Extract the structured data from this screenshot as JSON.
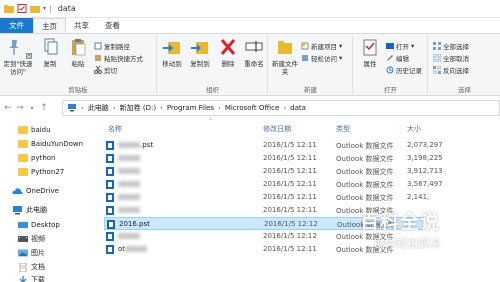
{
  "window": {
    "title": "data"
  },
  "tabs": [
    {
      "label": "文件"
    },
    {
      "label": "主页"
    },
    {
      "label": "共享"
    },
    {
      "label": "查看"
    }
  ],
  "ribbon": {
    "clipboard": {
      "pin_label": "固定到\"快速访问\"",
      "copy_label": "复制",
      "paste_label": "粘贴",
      "copy_path_label": "复制路径",
      "paste_shortcut_label": "粘贴快捷方式",
      "cut_label": "剪切",
      "group_label": "剪贴板"
    },
    "organize": {
      "move_to_label": "移动到",
      "copy_to_label": "复制到",
      "delete_label": "删除",
      "rename_label": "重命名",
      "group_label": "组织"
    },
    "new": {
      "new_folder_label": "新建文件夹",
      "new_item_label": "新建项目",
      "easy_access_label": "轻松访问",
      "group_label": "新建"
    },
    "open": {
      "properties_label": "属性",
      "open_label": "打开",
      "edit_label": "编辑",
      "history_label": "历史记录",
      "group_label": "打开"
    },
    "select": {
      "select_all_label": "全部选择",
      "select_none_label": "全部取消",
      "invert_label": "反向选择",
      "group_label": "选择"
    }
  },
  "address": {
    "crumbs": [
      "此电脑",
      "新加卷 (D:)",
      "Program Files",
      "Microsoft Office",
      "data"
    ]
  },
  "nav": {
    "quick_folders": [
      "baidu",
      "BaiduYunDown",
      "python",
      "Python27"
    ],
    "onedrive": "OneDrive",
    "this_pc": "此电脑",
    "pc_items": [
      "Desktop",
      "视频",
      "图片",
      "文档",
      "下载"
    ]
  },
  "columns": {
    "name": "名称",
    "date": "修改日期",
    "type": "类型",
    "size": "大小"
  },
  "files": [
    {
      "name_suffix": ".pst",
      "date": "2016/1/5 12:11",
      "type": "Outlook 数据文件",
      "size": "2,073,297"
    },
    {
      "name_suffix": "",
      "date": "2016/1/5 12:11",
      "type": "Outlook 数据文件",
      "size": "3,198,225"
    },
    {
      "name_suffix": "",
      "date": "2016/1/5 12:11",
      "type": "Outlook 数据文件",
      "size": "3,912,713"
    },
    {
      "name_suffix": "",
      "date": "2016/1/5 12:11",
      "type": "Outlook 数据文件",
      "size": "3,567,497"
    },
    {
      "name_suffix": "",
      "date": "2016/1/5 12:11",
      "type": "Outlook 数据文件",
      "size": "2,141,"
    },
    {
      "name_suffix": "",
      "date": "2016/1/5 12:11",
      "type": "Outlook 数据文件",
      "size": ""
    },
    {
      "name": "2016.pst",
      "date": "2016/1/5 12:12",
      "type": "Outlook 数据文件",
      "size": ""
    },
    {
      "name_suffix": "",
      "date": "2016/1/5 12:12",
      "type": "Outlook 数据文件",
      "size": ""
    },
    {
      "name_prefix": "ot",
      "date": "2016/1/5 12:11",
      "type": "Outlook 数据文件",
      "size": ""
    }
  ],
  "watermark": {
    "title": "百科全说",
    "subtitle": "助你轻松解决"
  },
  "colors": {
    "file_tab": "#1979ca",
    "selection": "#cce8ff",
    "header_text": "#4d6e9a",
    "folder": "#f3c94a"
  }
}
